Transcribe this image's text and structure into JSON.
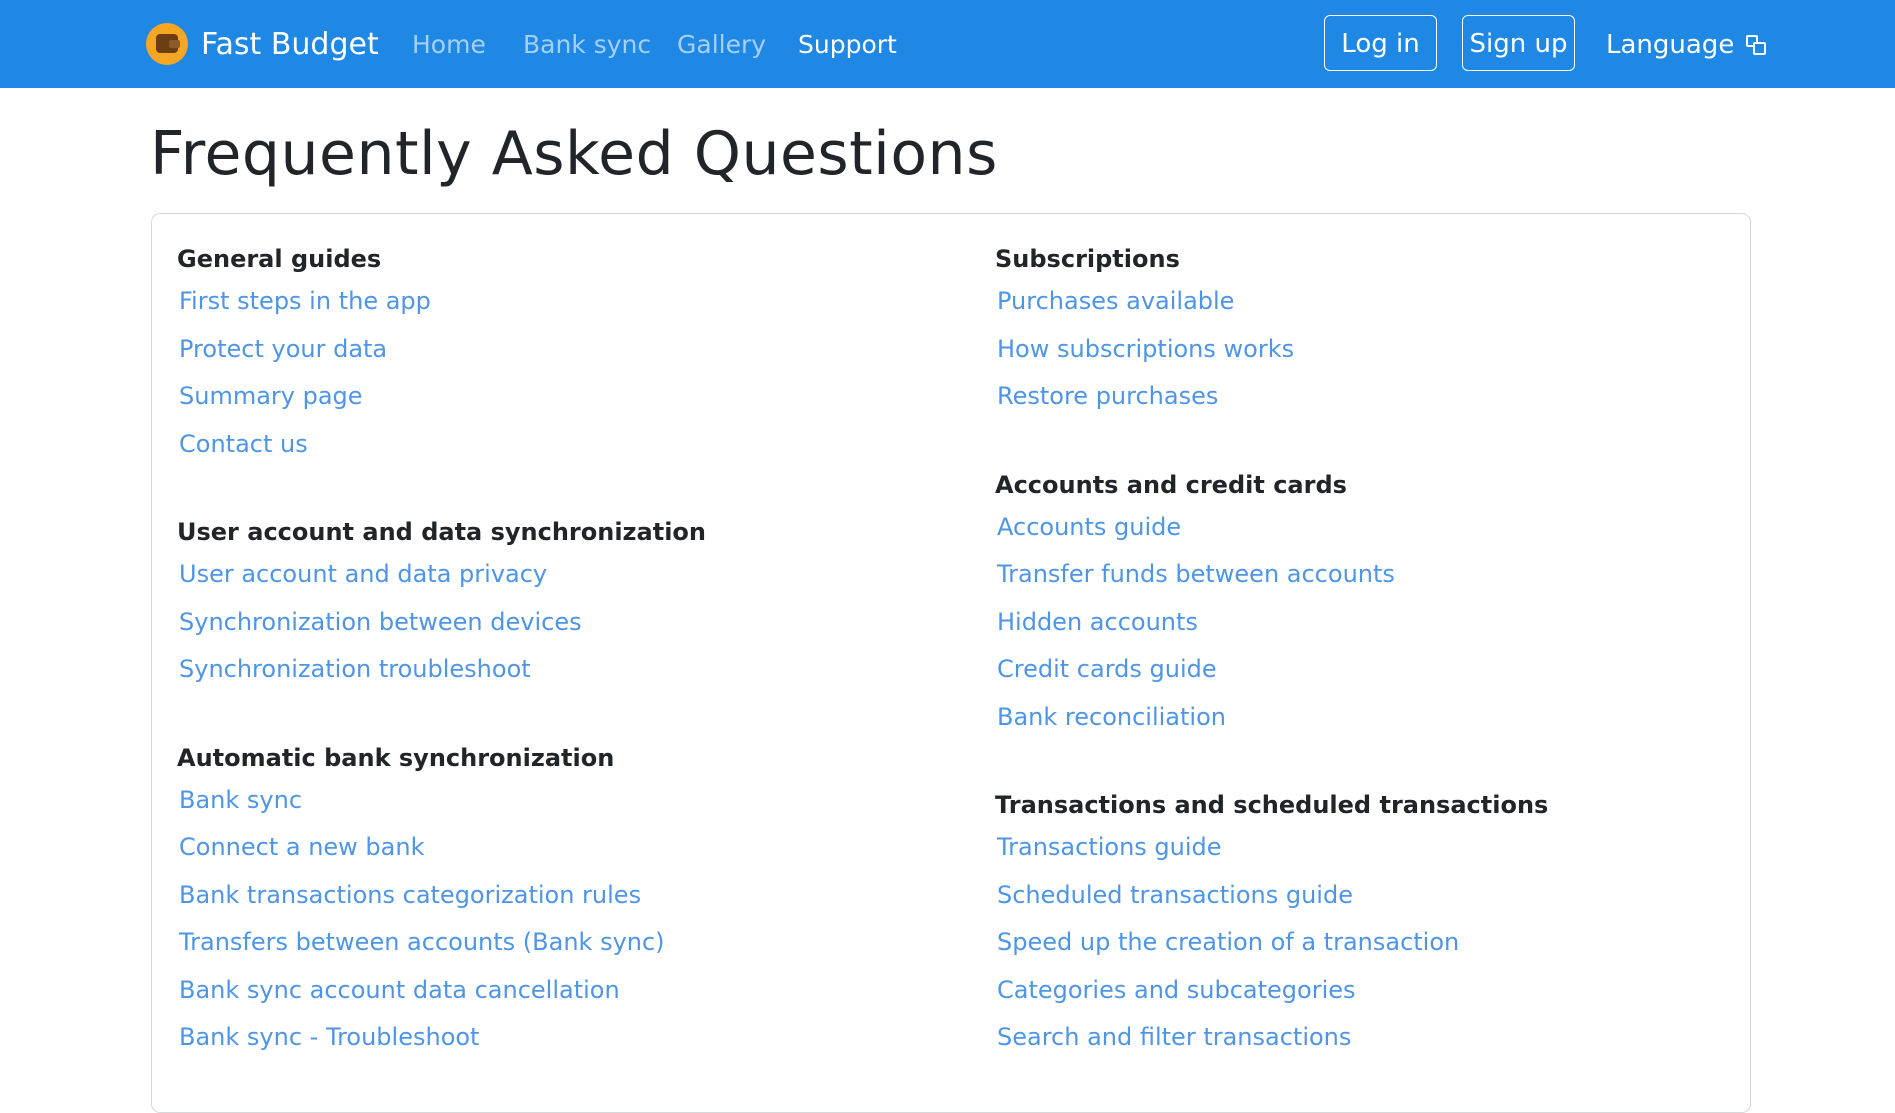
{
  "navbar": {
    "brand": "Fast Budget",
    "links": [
      "Home",
      "Bank sync",
      "Gallery",
      "Support"
    ],
    "login_label": "Log in",
    "signup_label": "Sign up",
    "language_label": "Language",
    "language_icon": "translate-icon"
  },
  "page": {
    "title": "Frequently Asked Questions"
  },
  "sections": {
    "left": [
      {
        "title": "General guides",
        "links": [
          "First steps in the app",
          "Protect your data",
          "Summary page",
          "Contact us"
        ]
      },
      {
        "title": "User account and data synchronization",
        "links": [
          "User account and data privacy",
          "Synchronization between devices",
          "Synchronization troubleshoot"
        ]
      },
      {
        "title": "Automatic bank synchronization",
        "links": [
          "Bank sync",
          "Connect a new bank",
          "Bank transactions categorization rules",
          "Transfers between accounts (Bank sync)",
          "Bank sync account data cancellation",
          "Bank sync - Troubleshoot"
        ]
      }
    ],
    "right": [
      {
        "title": "Subscriptions",
        "links": [
          "Purchases available",
          "How subscriptions works",
          "Restore purchases"
        ]
      },
      {
        "title": "Accounts and credit cards",
        "links": [
          "Accounts guide",
          "Transfer funds between accounts",
          "Hidden accounts",
          "Credit cards guide",
          "Bank reconciliation"
        ]
      },
      {
        "title": "Transactions and scheduled transactions",
        "links": [
          "Transactions guide",
          "Scheduled transactions guide",
          "Speed up the creation of a transaction",
          "Categories and subcategories",
          "Search and filter transactions"
        ]
      }
    ]
  },
  "colors": {
    "navbar": "#1f88e5",
    "link": "#4f95e6",
    "heading": "#212529"
  }
}
